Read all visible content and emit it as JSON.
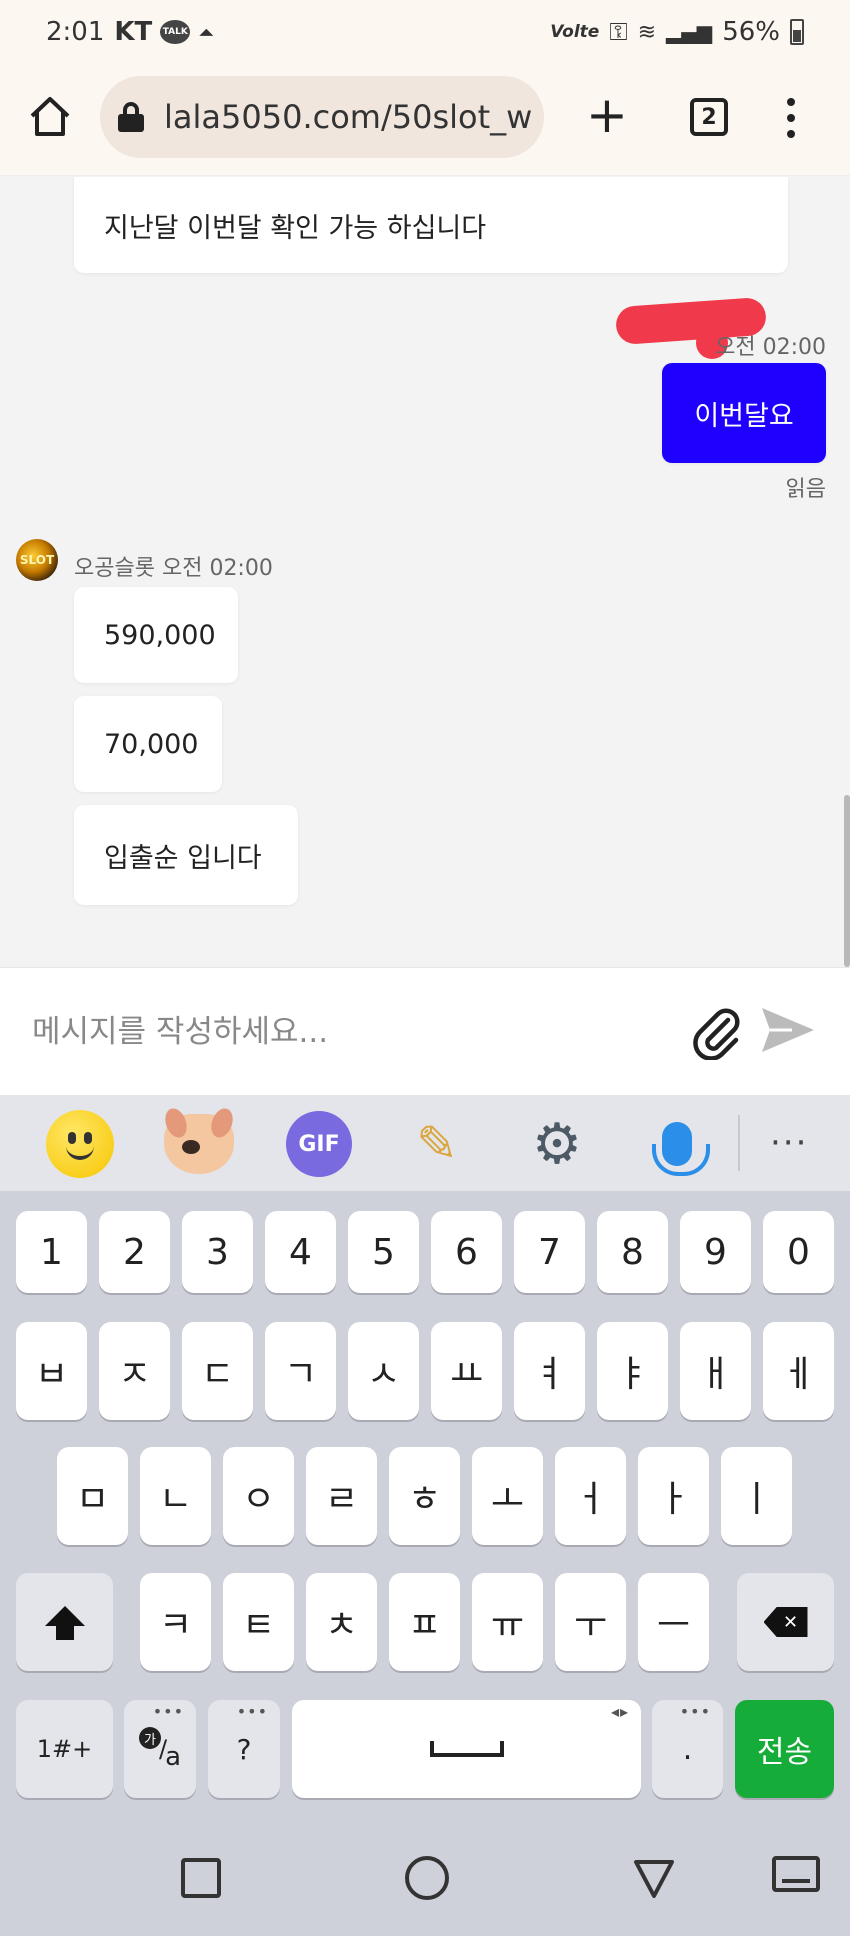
{
  "status_bar": {
    "time": "2:01",
    "carrier": "KT",
    "talk_label": "TALK",
    "volte": "Volte",
    "battery": "56%"
  },
  "browser": {
    "url": "lala5050.com/50slot_w",
    "tab_count": "2"
  },
  "chat": {
    "messages": [
      {
        "text": "지난달 이번달 확인 가능 하십니다"
      },
      {
        "time": "오전 02:00",
        "text": "이번달요",
        "read_status": "읽음"
      },
      {
        "sender": "오공슬롯",
        "time": "오전 02:00",
        "avatar_text": "SLOT"
      },
      {
        "text": "590,000"
      },
      {
        "text": "70,000"
      },
      {
        "text": "입출순 입니다"
      }
    ]
  },
  "composer": {
    "placeholder": "메시지를 작성하세요..."
  },
  "keyboard": {
    "toolbar": {
      "gif": "GIF",
      "more": "···"
    },
    "rows": {
      "numbers": [
        "1",
        "2",
        "3",
        "4",
        "5",
        "6",
        "7",
        "8",
        "9",
        "0"
      ],
      "row1": [
        "ㅂ",
        "ㅈ",
        "ㄷ",
        "ㄱ",
        "ㅅ",
        "ㅛ",
        "ㅕ",
        "ㅑ",
        "ㅐ",
        "ㅔ"
      ],
      "row2": [
        "ㅁ",
        "ㄴ",
        "ㅇ",
        "ㄹ",
        "ㅎ",
        "ㅗ",
        "ㅓ",
        "ㅏ",
        "ㅣ"
      ],
      "row3": [
        "ㅋ",
        "ㅌ",
        "ㅊ",
        "ㅍ",
        "ㅠ",
        "ㅜ",
        "ㅡ"
      ]
    },
    "bottom": {
      "symbols": "1#+",
      "lang_small": "가",
      "lang_big": "a",
      "question": "?",
      "period": ".",
      "send": "전송",
      "dots": "•••",
      "arrows": "◂▸"
    }
  },
  "colors": {
    "my_bubble": "#1f00ff",
    "send_key": "#16ac3a",
    "redaction": "#f03a4b"
  }
}
